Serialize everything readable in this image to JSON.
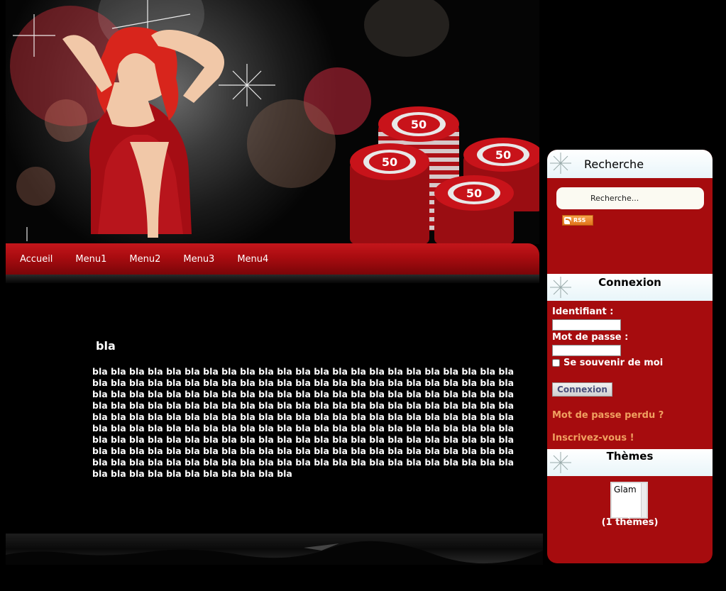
{
  "nav": {
    "items": [
      "Accueil",
      "Menu1",
      "Menu2",
      "Menu3",
      "Menu4"
    ]
  },
  "article": {
    "title": "bla",
    "body": "bla bla bla bla bla bla bla bla bla bla bla bla bla bla bla bla bla bla bla bla bla bla bla bla bla bla bla bla bla bla bla bla bla bla bla bla bla bla bla bla bla bla bla bla bla bla bla bla bla bla bla bla bla bla bla bla bla bla bla bla bla bla bla bla bla bla bla bla bla bla bla bla bla bla bla bla bla bla bla bla bla bla bla bla bla bla bla bla bla bla bla bla bla bla bla bla bla bla bla bla bla bla bla bla bla bla bla bla bla bla bla bla bla bla bla bla bla bla bla bla bla bla bla bla bla bla bla bla bla bla bla bla bla bla bla bla bla bla bla bla bla bla bla bla bla bla bla bla bla bla bla bla bla bla bla bla bla bla bla bla bla bla bla bla bla bla bla bla bla bla bla bla bla bla bla bla bla bla bla bla bla bla bla bla bla bla bla bla bla bla bla bla bla bla bla bla bla bla bla bla bla bla bla bla bla bla bla bla bla bla bla bla bla bla bla bla bla bla"
  },
  "banner": {
    "chip_value": "50"
  },
  "sidebar": {
    "search": {
      "title": "Recherche",
      "placeholder": "Recherche...",
      "rss_label": "RSS"
    },
    "login": {
      "title": "Connexion",
      "username_label": "Identifiant :",
      "password_label": "Mot de passe :",
      "remember_label": "Se souvenir de moi",
      "submit_label": "Connexion",
      "forgot_link": "Mot de passe perdu ?",
      "register_link": "Inscrivez-vous !"
    },
    "themes": {
      "title": "Thèmes",
      "options": [
        "Glam"
      ],
      "count_label": "(1 thèmes)"
    }
  },
  "colors": {
    "accent_red": "#a60c0e",
    "nav_red": "#c4161b",
    "link_orange": "#f0a060",
    "panel_header": "#e8f5f9",
    "background": "#000000"
  },
  "icons": {
    "sidebar_header": "sparkle-icon",
    "rss": "rss-icon"
  }
}
